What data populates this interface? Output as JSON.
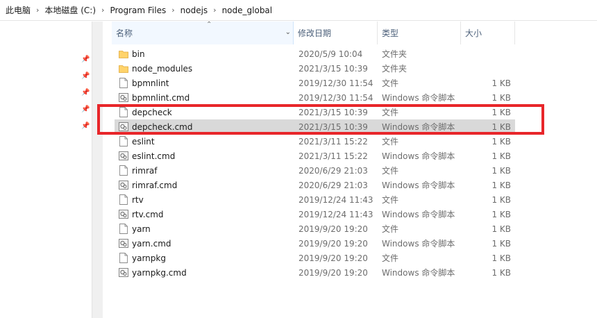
{
  "breadcrumb": [
    "此电脑",
    "本地磁盘 (C:)",
    "Program Files",
    "nodejs",
    "node_global"
  ],
  "columns": {
    "name": "名称",
    "date": "修改日期",
    "type": "类型",
    "size": "大小"
  },
  "files": [
    {
      "name": "bin",
      "date": "2020/5/9 10:04",
      "type": "文件夹",
      "size": "",
      "kind": "folder"
    },
    {
      "name": "node_modules",
      "date": "2021/3/15 10:39",
      "type": "文件夹",
      "size": "",
      "kind": "folder"
    },
    {
      "name": "bpmnlint",
      "date": "2019/12/30 11:54",
      "type": "文件",
      "size": "1 KB",
      "kind": "file"
    },
    {
      "name": "bpmnlint.cmd",
      "date": "2019/12/30 11:54",
      "type": "Windows 命令脚本",
      "size": "1 KB",
      "kind": "cmd"
    },
    {
      "name": "depcheck",
      "date": "2021/3/15 10:39",
      "type": "文件",
      "size": "1 KB",
      "kind": "file"
    },
    {
      "name": "depcheck.cmd",
      "date": "2021/3/15 10:39",
      "type": "Windows 命令脚本",
      "size": "1 KB",
      "kind": "cmd",
      "selected": true
    },
    {
      "name": "eslint",
      "date": "2021/3/11 15:22",
      "type": "文件",
      "size": "1 KB",
      "kind": "file"
    },
    {
      "name": "eslint.cmd",
      "date": "2021/3/11 15:22",
      "type": "Windows 命令脚本",
      "size": "1 KB",
      "kind": "cmd"
    },
    {
      "name": "rimraf",
      "date": "2020/6/29 21:03",
      "type": "文件",
      "size": "1 KB",
      "kind": "file"
    },
    {
      "name": "rimraf.cmd",
      "date": "2020/6/29 21:03",
      "type": "Windows 命令脚本",
      "size": "1 KB",
      "kind": "cmd"
    },
    {
      "name": "rtv",
      "date": "2019/12/24 11:43",
      "type": "文件",
      "size": "1 KB",
      "kind": "file"
    },
    {
      "name": "rtv.cmd",
      "date": "2019/12/24 11:43",
      "type": "Windows 命令脚本",
      "size": "1 KB",
      "kind": "cmd"
    },
    {
      "name": "yarn",
      "date": "2019/9/20 19:20",
      "type": "文件",
      "size": "1 KB",
      "kind": "file"
    },
    {
      "name": "yarn.cmd",
      "date": "2019/9/20 19:20",
      "type": "Windows 命令脚本",
      "size": "1 KB",
      "kind": "cmd"
    },
    {
      "name": "yarnpkg",
      "date": "2019/9/20 19:20",
      "type": "文件",
      "size": "1 KB",
      "kind": "file"
    },
    {
      "name": "yarnpkg.cmd",
      "date": "2019/9/20 19:20",
      "type": "Windows 命令脚本",
      "size": "1 KB",
      "kind": "cmd"
    }
  ],
  "icons": {
    "pin": "pin-icon",
    "folder": "folder-icon",
    "file": "file-icon",
    "cmd": "cmd-script-icon"
  },
  "colors": {
    "highlight": "#e8262a",
    "selected_row": "#d9d9d9",
    "folder": "#ffd36b"
  }
}
